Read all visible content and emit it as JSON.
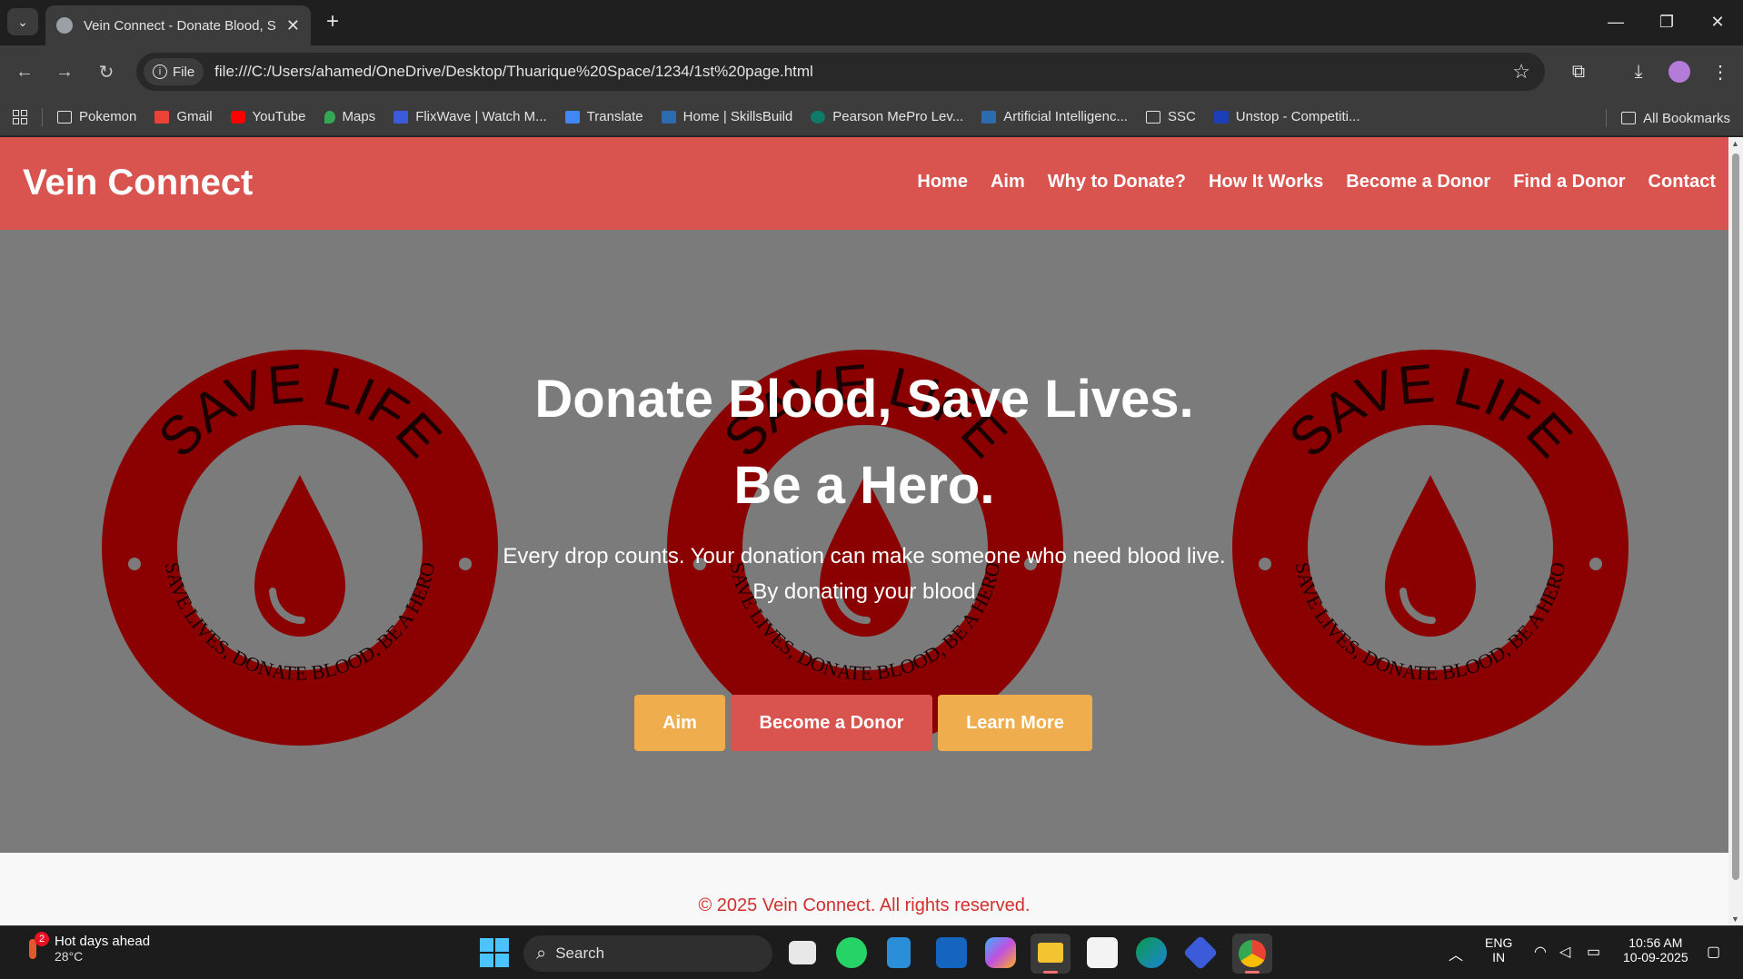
{
  "browser": {
    "tab_title": "Vein Connect - Donate Blood, S",
    "new_tab": "+",
    "url_chip": "File",
    "url": "file:///C:/Users/ahamed/OneDrive/Desktop/Thuarique%20Space/1234/1st%20page.html",
    "bookmarks": [
      "Pokemon",
      "Gmail",
      "YouTube",
      "Maps",
      "FlixWave | Watch M...",
      "Translate",
      "Home | SkillsBuild",
      "Pearson MePro Lev...",
      "Artificial Intelligenc...",
      "SSC",
      "Unstop - Competiti..."
    ],
    "all_bookmarks": "All Bookmarks"
  },
  "site": {
    "logo": "Vein Connect",
    "nav": [
      "Home",
      "Aim",
      "Why to Donate?",
      "How It Works",
      "Become a Donor",
      "Find a Donor",
      "Contact"
    ],
    "hero": {
      "heading_line1": "Donate Blood, Save Lives.",
      "heading_line2": "Be a Hero.",
      "text_line1": "Every drop counts. Your donation can make someone who need blood live.",
      "text_line2": "By donating your blood",
      "buttons": [
        "Aim",
        "Become a Donor",
        "Learn More"
      ],
      "badge_top_text": "SAVE LIFE",
      "badge_bottom_text": "SAVE LIVES, DONATE BLOOD, BE A HERO"
    },
    "footer": "© 2025 Vein Connect. All rights reserved."
  },
  "taskbar": {
    "weather_title": "Hot days ahead",
    "weather_temp": "28°C",
    "weather_badge": "2",
    "search_label": "Search",
    "lang_line1": "ENG",
    "lang_line2": "IN",
    "time": "10:56 AM",
    "date": "10-09-2025"
  },
  "colors": {
    "header_red": "#d9534f",
    "button_yellow": "#f0ad4e",
    "hero_overlay": "#7b7b7b",
    "badge_red": "#8b0000",
    "footer_text": "#d32f2f"
  }
}
